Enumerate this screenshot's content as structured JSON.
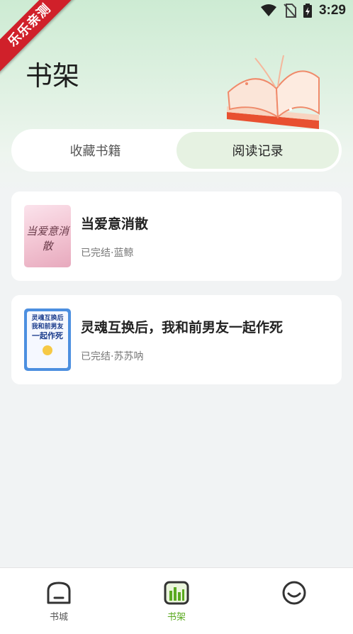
{
  "status_bar": {
    "time": "3:29",
    "icons": [
      "wifi-icon",
      "no-sim-icon",
      "battery-charging-icon"
    ]
  },
  "badge": {
    "text": "乐乐亲测"
  },
  "header": {
    "title": "书架"
  },
  "tabs": [
    {
      "label": "收藏书籍",
      "active": false
    },
    {
      "label": "阅读记录",
      "active": true
    }
  ],
  "books": [
    {
      "title": "当爱意消散",
      "meta": "已完结·蓝鲸",
      "cover_text": "当爱意消散"
    },
    {
      "title": "灵魂互换后，我和前男友一起作死",
      "meta": "已完结·苏苏呐",
      "cover_lines": [
        "灵魂互换后",
        "我和前男友",
        "一起作死"
      ]
    }
  ],
  "bottom_nav": [
    {
      "label": "书城",
      "icon": "bookstore-icon",
      "active": false
    },
    {
      "label": "书架",
      "icon": "bookshelf-icon",
      "active": true
    },
    {
      "label": "",
      "icon": "profile-smile-icon",
      "active": false
    }
  ],
  "colors": {
    "accent": "#5aa91e",
    "tab_active_bg": "#e6f2e2",
    "badge_red": "#d0202a"
  }
}
